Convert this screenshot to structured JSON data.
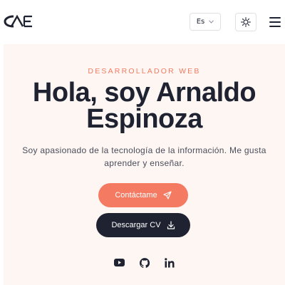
{
  "header": {
    "logo_text": "CAE",
    "language_select": {
      "value": "Es"
    },
    "theme_toggle_icon": "sun-icon",
    "menu_icon": "hamburger-menu-icon"
  },
  "hero": {
    "eyebrow": "DESARROLLADOR WEB",
    "title_line1": "Hola, soy Arnaldo",
    "title_line2": "Espinoza",
    "subtitle": "Soy apasionado de la tecnología de la información. Me gusta aprender y enseñar.",
    "contact_button": {
      "label": "Contáctame",
      "icon": "send-icon"
    },
    "cv_button": {
      "label": "Descargar CV",
      "icon": "download-icon"
    }
  },
  "socials": [
    {
      "name": "youtube",
      "icon": "youtube-icon"
    },
    {
      "name": "github",
      "icon": "github-icon"
    },
    {
      "name": "linkedin",
      "icon": "linkedin-icon"
    }
  ],
  "colors": {
    "accent": "#f47a62",
    "dark": "#1f2230",
    "hero_background": "#fdf6f2",
    "text_muted": "#4a4d5c"
  }
}
